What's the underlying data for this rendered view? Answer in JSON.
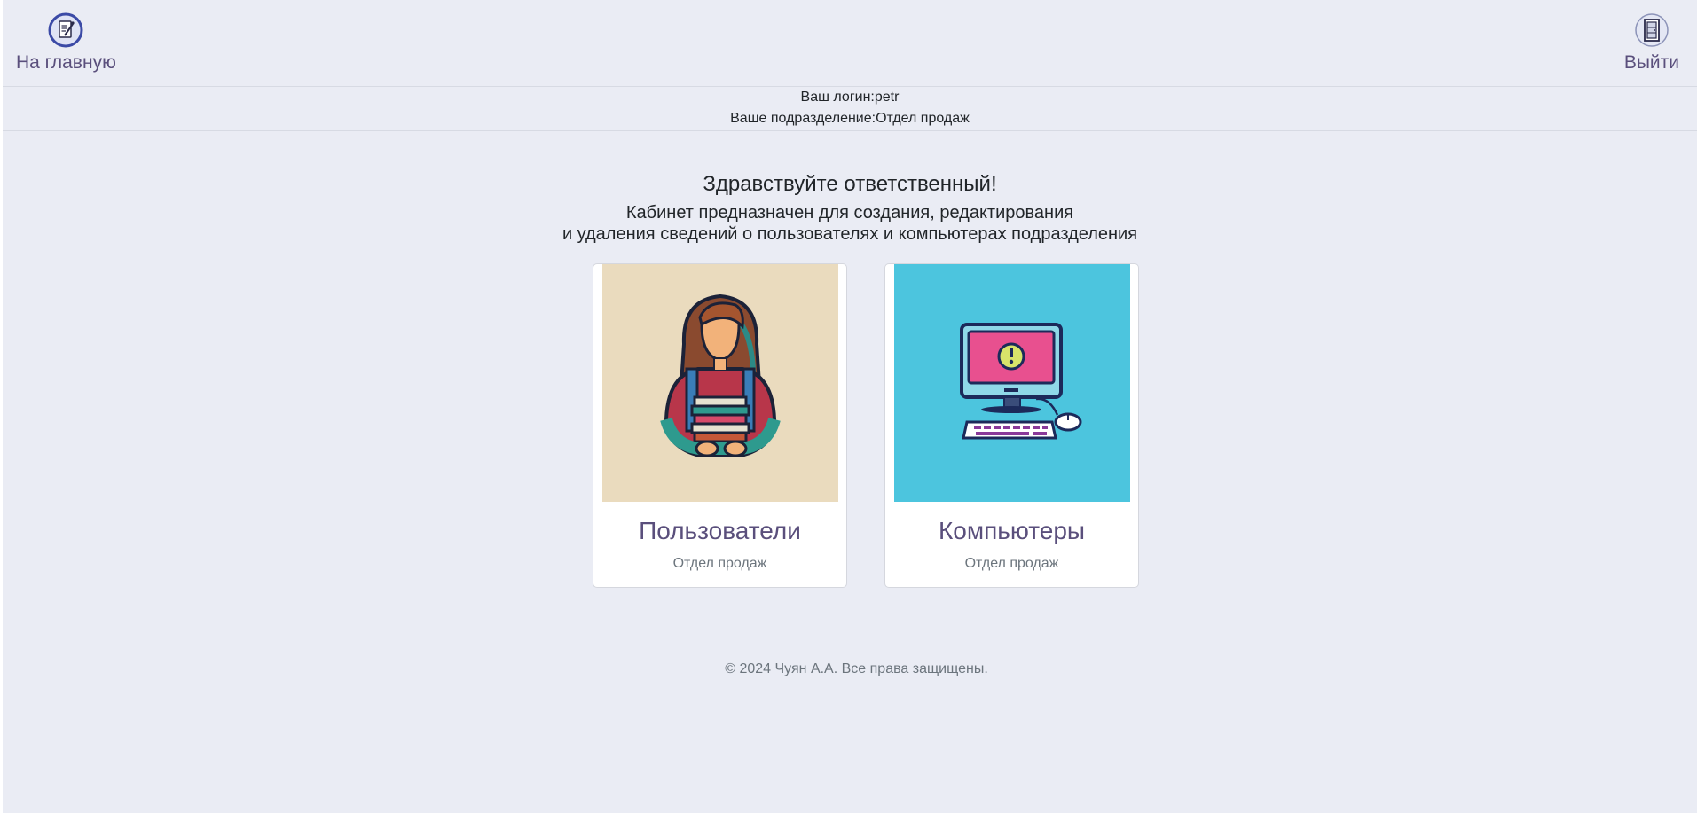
{
  "nav": {
    "home_label": "На главную",
    "home_icon": "document-edit-icon",
    "logout_label": "Выйти",
    "logout_icon": "door-exit-icon"
  },
  "info": {
    "login_label": "Ваш логин:",
    "login_value": "petr",
    "department_label": "Ваше подразделение:",
    "department_value": "Отдел продаж"
  },
  "main": {
    "greeting": "Здравствуйте ответственный!",
    "description_line1": "Кабинет предназначен для создания, редактирования",
    "description_line2": "и удаления сведений о пользователях и компьютерах подразделения"
  },
  "cards": [
    {
      "title": "Пользователи",
      "subtitle": "Отдел продаж",
      "image": "user-with-books-illustration",
      "bg_color": "#eadbbe"
    },
    {
      "title": "Компьютеры",
      "subtitle": "Отдел продаж",
      "image": "computer-warning-illustration",
      "bg_color": "#4cc5de"
    }
  ],
  "footer": {
    "text": "© 2024 Чуян А.А. Все права защищены."
  },
  "colors": {
    "background": "#eaecf4",
    "accent": "#5a4f7c"
  }
}
